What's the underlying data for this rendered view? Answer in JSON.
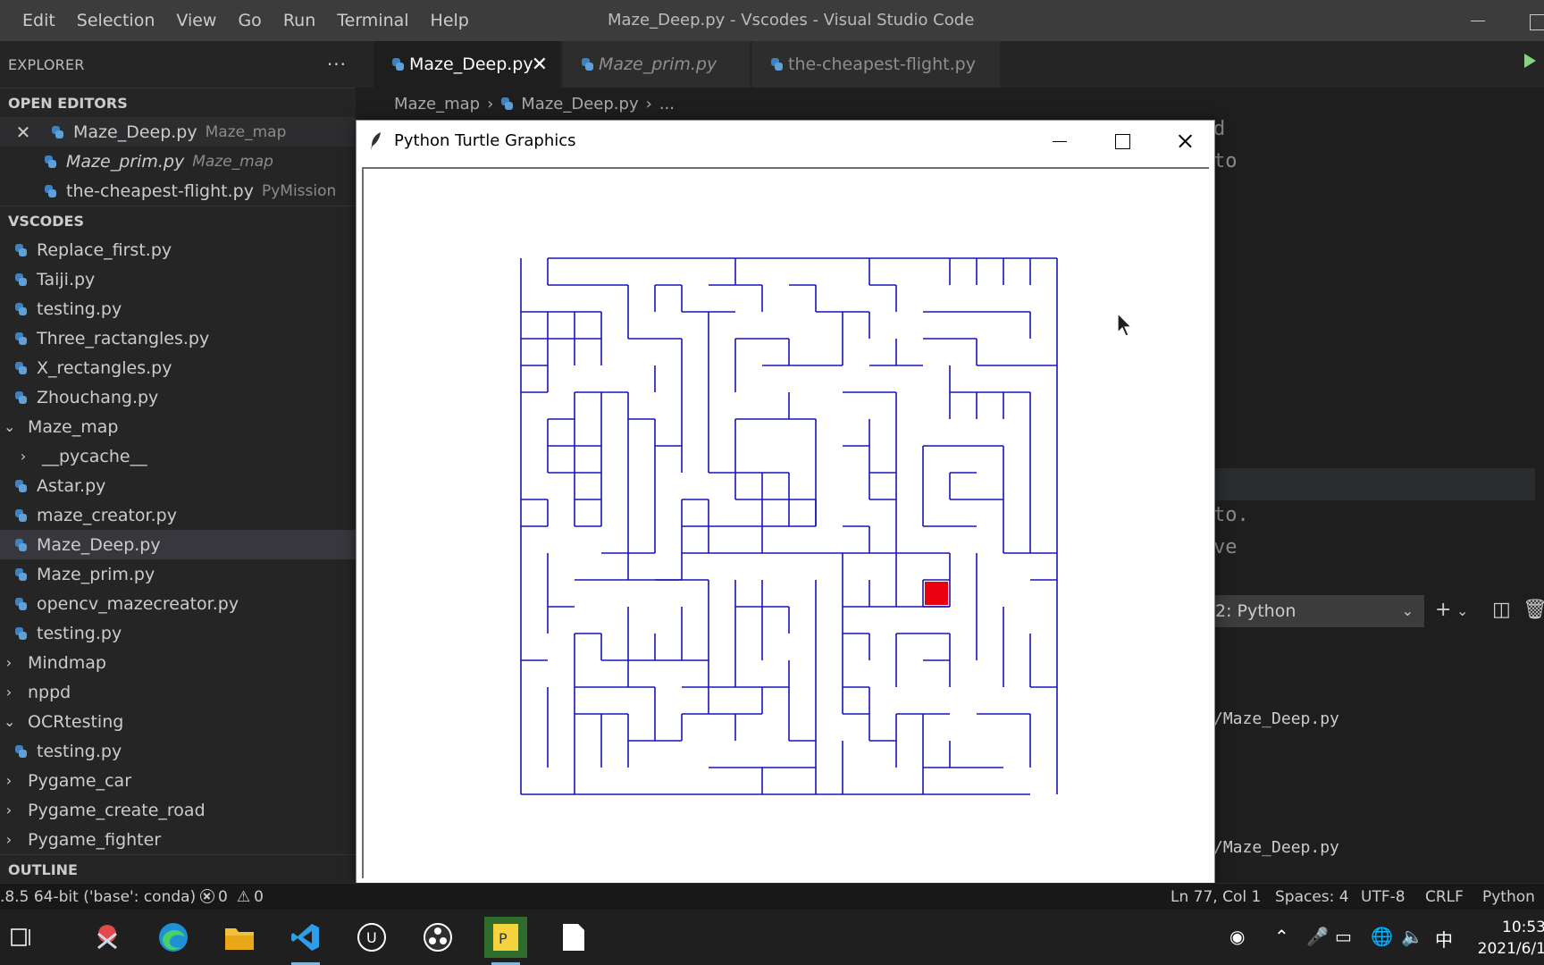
{
  "menu": [
    "Edit",
    "Selection",
    "View",
    "Go",
    "Run",
    "Terminal",
    "Help"
  ],
  "window_title": "Maze_Deep.py - Vscodes - Visual Studio Code",
  "sidebar": {
    "header": "EXPLORER",
    "more": "···",
    "open_editors_title": "OPEN EDITORS",
    "open_editors": [
      {
        "name": "Maze_Deep.py",
        "folder": "Maze_map",
        "close": "✕"
      },
      {
        "name": "Maze_prim.py",
        "folder": "Maze_map"
      },
      {
        "name": "the-cheapest-flight.py",
        "folder": "PyMission"
      }
    ],
    "workspace_title": "VSCODES",
    "tree": {
      "replace_first": "Replace_first.py",
      "taiji": "Taiji.py",
      "testing1": "testing.py",
      "three_rect": "Three_ractangles.py",
      "x_rect": "X_rectangles.py",
      "zhouchang": "Zhouchang.py",
      "maze_map": "Maze_map",
      "pycache": "__pycache__",
      "astar": "Astar.py",
      "maze_creator": "maze_creator.py",
      "maze_deep": "Maze_Deep.py",
      "maze_prim": "Maze_prim.py",
      "opencv": "opencv_mazecreator.py",
      "testing2": "testing.py",
      "mindmap": "Mindmap",
      "nppd": "nppd",
      "ocrtesting": "OCRtesting",
      "testing3": "testing.py",
      "pygame_car": "Pygame_car",
      "pygame_road": "Pygame_create_road",
      "pygame_fighter": "Pygame_fighter"
    },
    "outline_title": "OUTLINE"
  },
  "tabs": [
    {
      "label": "Maze_Deep.py",
      "close": "✕"
    },
    {
      "label": "Maze_prim.py"
    },
    {
      "label": "the-cheapest-flight.py"
    }
  ],
  "breadcrumb": {
    "folder": "Maze_map",
    "file": "Maze_Deep.py",
    "more": "..."
  },
  "editor_fragments": {
    "l1": "d",
    "l2": "to",
    "l3": "to.",
    "l4": "ve"
  },
  "panel": {
    "terminal_select": "2: Python",
    "plus": "+",
    "term_line1": "/Maze_Deep.py",
    "term_line2": "/Maze_Deep.py"
  },
  "turtle_window": {
    "title": "Python Turtle Graphics",
    "maze_color": "#1a14b8",
    "marker_color": "#e8000e"
  },
  "statusbar": {
    "interpreter": ".8.5 64-bit ('base': conda)",
    "errors": "0",
    "warnings": "0",
    "position": "Ln 77, Col 1",
    "spaces": "Spaces: 4",
    "encoding": "UTF-8",
    "eol": "CRLF",
    "language": "Python"
  },
  "taskbar": {
    "ime": "中",
    "time": "10:53",
    "date": "2021/6/1"
  }
}
